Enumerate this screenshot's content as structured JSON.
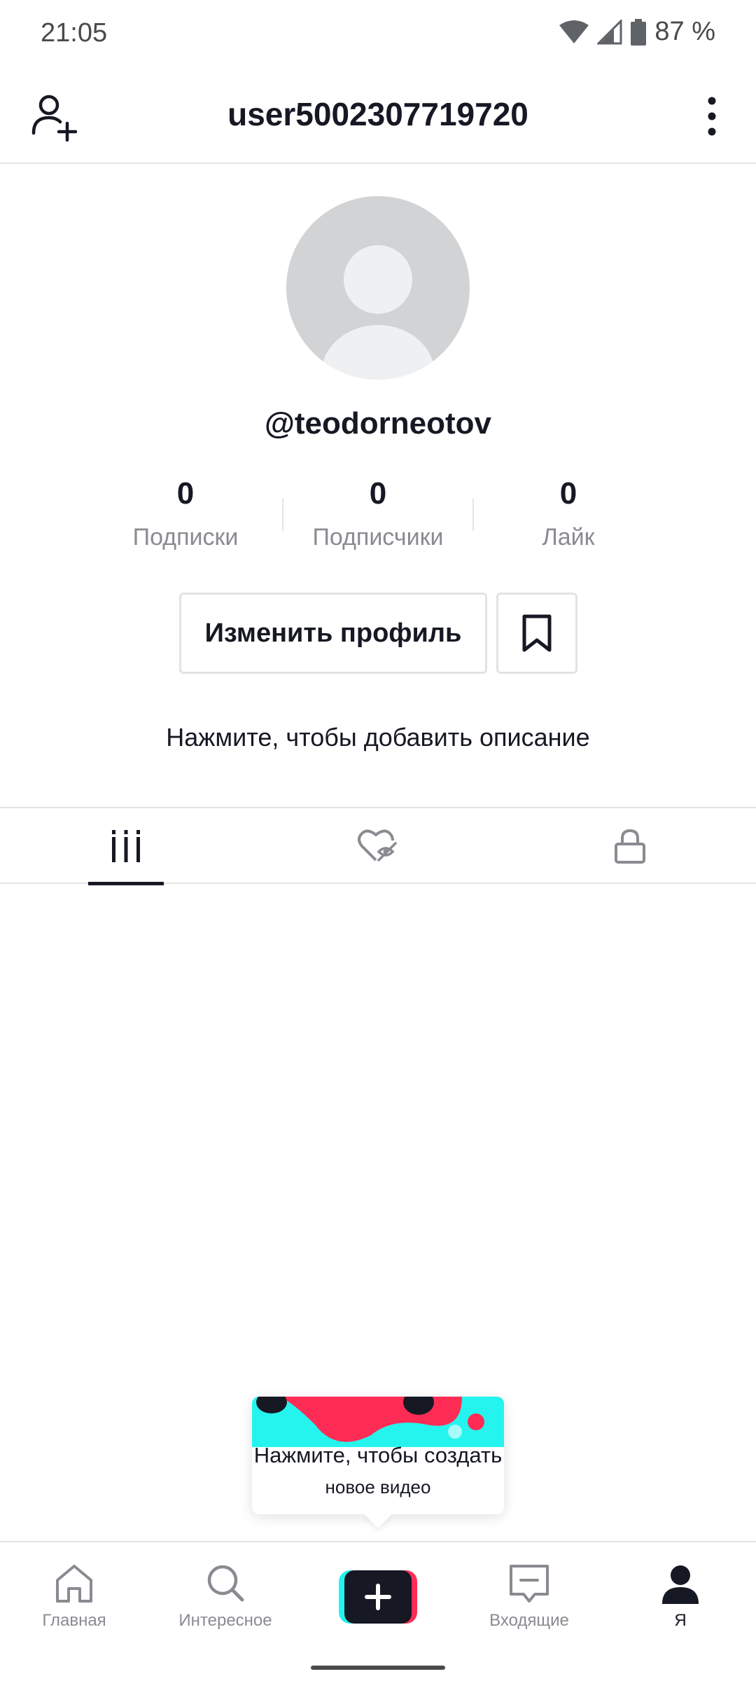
{
  "status_bar": {
    "time": "21:05",
    "battery": "87 %"
  },
  "header": {
    "title": "user5002307719720"
  },
  "profile": {
    "username": "@teodorneotov",
    "bio_prompt": "Нажмите, чтобы добавить описание",
    "edit_button_label": "Изменить профиль"
  },
  "stats": [
    {
      "value": "0",
      "label": "Подписки"
    },
    {
      "value": "0",
      "label": "Подписчики"
    },
    {
      "value": "0",
      "label": "Лайк"
    }
  ],
  "tabs": [
    {
      "icon": "grid-videos-icon",
      "active": true
    },
    {
      "icon": "liked-hidden-icon",
      "active": false
    },
    {
      "icon": "lock-icon",
      "active": false
    }
  ],
  "tooltip": {
    "line1": "Нажмите, чтобы создать",
    "line2": "новое видео"
  },
  "nav": {
    "home": "Главная",
    "discover": "Интересное",
    "inbox": "Входящие",
    "me": "Я"
  },
  "colors": {
    "accent_red": "#fe2c55",
    "accent_cyan": "#25f4ee",
    "text": "#161823",
    "muted": "#8a8b91"
  }
}
